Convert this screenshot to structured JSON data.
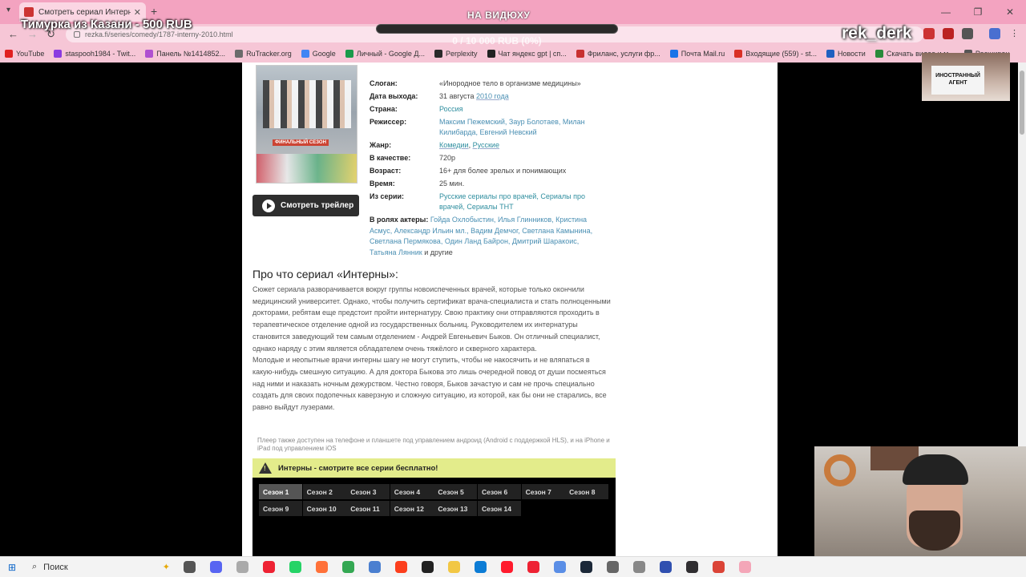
{
  "browser": {
    "tab_title": "Смотреть сериал Интерны он",
    "url": "rezka.fi/series/comedy/1787-interny-2010.html",
    "bookmarks": [
      {
        "label": "YouTube",
        "color": "#e02020"
      },
      {
        "label": "staspooh1984 - Twit...",
        "color": "#8a3be0"
      },
      {
        "label": "Панель №1414852...",
        "color": "#b050d0"
      },
      {
        "label": "RuTracker.org",
        "color": "#6b6b6b"
      },
      {
        "label": "Google",
        "color": "#4285f4"
      },
      {
        "label": "Личный - Google Д...",
        "color": "#1a9a4a"
      },
      {
        "label": "Perplexity",
        "color": "#2a2a2a"
      },
      {
        "label": "Чат яндекс gpt | сп...",
        "color": "#222"
      },
      {
        "label": "Фриланс, услуги фр...",
        "color": "#c83030"
      },
      {
        "label": "Почта Mail.ru",
        "color": "#1a73e8"
      },
      {
        "label": "Входящие (559) - st...",
        "color": "#d93025"
      },
      {
        "label": "Новости",
        "color": "#2060c0"
      },
      {
        "label": "Скачать видео и м...",
        "color": "#2a8a3a"
      },
      {
        "label": "Расширен",
        "color": "#555"
      }
    ]
  },
  "overlay": {
    "goal_title": "НА ВИДЮХУ",
    "goal_amount": "0 / 10 000 RUB (0%)",
    "donor": "Тимурка из Казани - 500 RUB",
    "nick": "rek_derk",
    "cam_sign": "ИНОСТРАННЫЙ АГЕНТ"
  },
  "poster": {
    "banner": "ФИНАЛЬНЫЙ СЕЗОН"
  },
  "trailer_label": "Смотреть трейлер",
  "info": {
    "slogan_k": "Слоган:",
    "slogan_v": "«Инородное тело в организме медицины»",
    "release_k": "Дата выхода:",
    "release_v": "31 августа",
    "release_year": "2010 года",
    "country_k": "Страна:",
    "country_v": "Россия",
    "director_k": "Режиссер:",
    "director_v": "Максим Пежемский, Заур Болотаев, Милан Килибарда, Евгений Невский",
    "genre_k": "Жанр:",
    "genre_v1": "Комедии",
    "genre_sep": ",",
    "genre_v2": "Русские",
    "quality_k": "В качестве:",
    "quality_v": "720p",
    "age_k": "Возраст:",
    "age_v": "16+",
    "age_note": "для более зрелых и понимающих",
    "time_k": "Время:",
    "time_v": "25 мин.",
    "from_k": "Из серии:",
    "from_v": "Русские сериалы про врачей, Сериалы про врачей, Сериалы ТНТ",
    "actors_k": "В ролях актеры:",
    "actors_v": "Гойда Охлобыстин, Илья Глинников, Кристина Асмус, Александр Ильин мл., Вадим Демчог, Светлана Камынина, Светлана Пермякова, Один Ланд Байрон, Дмитрий Шаракоис, Татьяна Лянник",
    "actors_tail": "и другие"
  },
  "about": {
    "heading": "Про что сериал «Интерны»:",
    "p1": "Сюжет сериала разворачивается вокруг группы новоиспеченных врачей, которые только окончили медицинский университет. Однако, чтобы получить сертификат врача-специалиста и стать полноценными докторами, ребятам еще предстоит пройти интернатуру. Свою практику они отправляются проходить в терапевтическое отделение одной из государственных больниц. Руководителем их интернатуры становится заведующий тем самым отделением - Андрей Евгеньевич Быков. Он отличный специалист, однако наряду с этим является обладателем очень тяжёлого и скверного характера.",
    "p2": "Молодые и неопытные врачи интерны шагу не могут ступить, чтобы не накосячить и не вляпаться в какую-нибудь смешную ситуацию. А для доктора Быкова это лишь очередной повод от души посмеяться над ними и наказать ночным дежурством. Честно говоря, Быков зачастую и сам не прочь специально создать для своих подопечных каверзную и сложную ситуацию, из которой, как бы они не старались, все равно выйдут лузерами."
  },
  "player_note": "Плеер также доступен на телефоне и планшете под управлением андроид (Android с поддержкой HLS), и на iPhone и iPad под управлением iOS",
  "watch_free": "Интерны - смотрите все серии бесплатно!",
  "seasons": [
    "Сезон 1",
    "Сезон 2",
    "Сезон 3",
    "Сезон 4",
    "Сезон 5",
    "Сезон 6",
    "Сезон 7",
    "Сезон 8",
    "Сезон 9",
    "Сезон 10",
    "Сезон 11",
    "Сезон 12",
    "Сезон 13",
    "Сезон 14"
  ],
  "taskbar": {
    "search_label": "Поиск",
    "apps": [
      {
        "name": "task-view-icon",
        "color": "#555"
      },
      {
        "name": "discord-icon",
        "color": "#5865f2"
      },
      {
        "name": "explorer-icon",
        "color": "#aaa"
      },
      {
        "name": "yandex-browser-icon",
        "color": "#e23"
      },
      {
        "name": "whatsapp-icon",
        "color": "#25d366"
      },
      {
        "name": "firefox-icon",
        "color": "#ff7139"
      },
      {
        "name": "chrome-icon",
        "color": "#34a853"
      },
      {
        "name": "app-icon",
        "color": "#4a7fd0"
      },
      {
        "name": "yandex-icon",
        "color": "#fc3f1d"
      },
      {
        "name": "app-dark-icon",
        "color": "#222"
      },
      {
        "name": "folder-icon",
        "color": "#f2c744"
      },
      {
        "name": "edge-icon",
        "color": "#0c7cd5"
      },
      {
        "name": "opera-icon",
        "color": "#ff1b2d"
      },
      {
        "name": "yandex-music-icon",
        "color": "#e23"
      },
      {
        "name": "chromium-icon",
        "color": "#5a8ee6"
      },
      {
        "name": "steam-icon",
        "color": "#1b2838"
      },
      {
        "name": "globe-icon",
        "color": "#666"
      },
      {
        "name": "grid-icon",
        "color": "#888"
      },
      {
        "name": "b-icon",
        "color": "#3050b0"
      },
      {
        "name": "obs-icon",
        "color": "#302e31"
      },
      {
        "name": "chrome2-icon",
        "color": "#db4437"
      },
      {
        "name": "active-app-icon",
        "color": "#f4a6b8"
      }
    ]
  }
}
